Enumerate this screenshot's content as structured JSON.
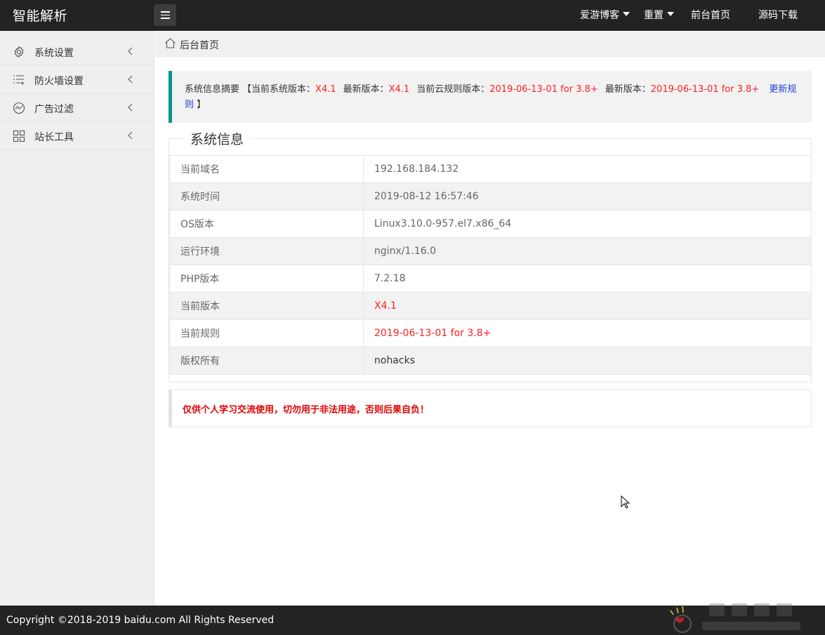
{
  "header": {
    "logo": "智能解析",
    "nav": [
      {
        "label": "爱游博客",
        "dropdown": true
      },
      {
        "label": "重置",
        "dropdown": true
      },
      {
        "label": "前台首页",
        "dropdown": false
      },
      {
        "label": "源码下载",
        "dropdown": false
      }
    ]
  },
  "sidebar": {
    "items": [
      {
        "label": "系统设置",
        "icon": "gear-icon"
      },
      {
        "label": "防火墙设置",
        "icon": "list-plus-icon"
      },
      {
        "label": "广告过滤",
        "icon": "trend-circle-icon"
      },
      {
        "label": "站长工具",
        "icon": "grid-icon"
      }
    ]
  },
  "breadcrumb": {
    "label": "后台首页"
  },
  "notice": {
    "lead": "系统信息摘要",
    "open": "【",
    "cur_label": "当前系统版本：",
    "cur_value": "X4.1",
    "latest_label": "最新版本：",
    "latest_value": "X4.1",
    "rule_label": "当前云规则版本：",
    "rule_value": "2019-06-13-01 for 3.8+",
    "latest_rule_label": "最新版本：",
    "latest_rule_value": "2019-06-13-01 for 3.8+",
    "link": "更新规则",
    "close": "】"
  },
  "system_info": {
    "title": "系统信息",
    "rows": [
      {
        "key": "当前域名",
        "value": "192.168.184.132",
        "style": "normal"
      },
      {
        "key": "系统时间",
        "value": "2019-08-12 16:57:46",
        "style": "normal"
      },
      {
        "key": "OS版本",
        "value": "Linux3.10.0-957.el7.x86_64",
        "style": "normal"
      },
      {
        "key": "运行环境",
        "value": "nginx/1.16.0",
        "style": "normal"
      },
      {
        "key": "PHP版本",
        "value": "7.2.18",
        "style": "normal"
      },
      {
        "key": "当前版本",
        "value": "X4.1",
        "style": "red"
      },
      {
        "key": "当前规则",
        "value": "2019-06-13-01 for 3.8+",
        "style": "red"
      },
      {
        "key": "版权所有",
        "value": "nohacks",
        "style": "dark"
      }
    ]
  },
  "warning": "仅供个人学习交流使用，切勿用于非法用途，否则后果自负！",
  "footer": {
    "copyright": "Copyright ©2018-2019 baidu.com All Rights Reserved"
  },
  "colors": {
    "header_bg": "#232323",
    "accent": "#009688",
    "red": "#ff2020",
    "link": "#1e3fd8"
  }
}
